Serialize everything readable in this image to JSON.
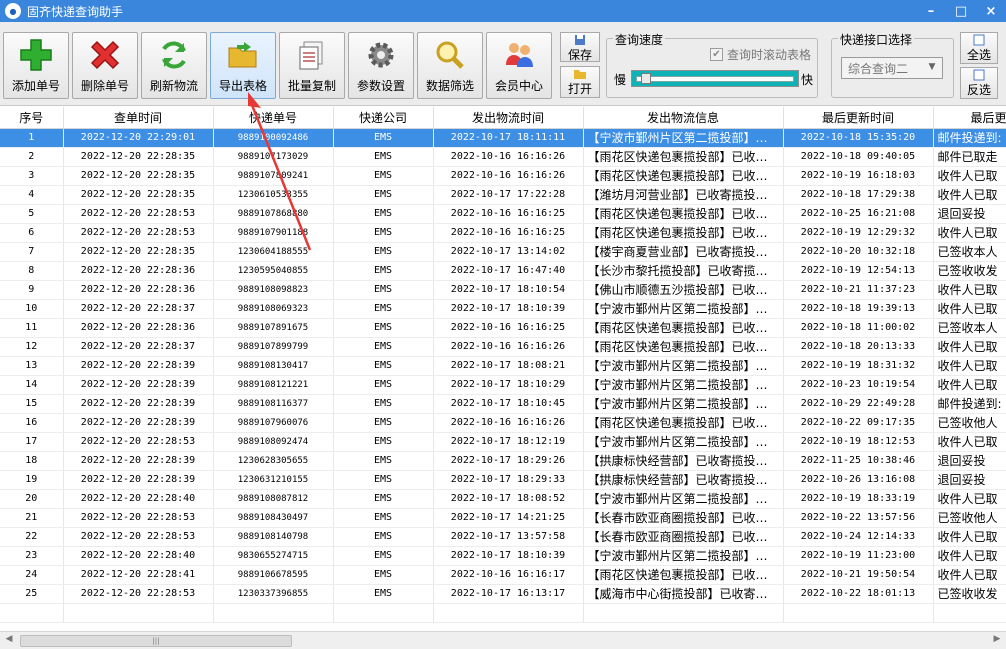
{
  "window": {
    "title": "固齐快递查询助手",
    "minimize": "–",
    "maximize": "□",
    "close": "×"
  },
  "toolbar": {
    "add": "添加单号",
    "delete": "删除单号",
    "refresh": "刷新物流",
    "export": "导出表格",
    "copy": "批量复制",
    "settings": "参数设置",
    "filter": "数据筛选",
    "member": "会员中心",
    "save": "保存",
    "open": "打开",
    "select_all": "全选",
    "invert": "反选"
  },
  "speed": {
    "legend": "查询速度",
    "auto_scroll": "查询时滚动表格",
    "slow": "慢",
    "fast": "快",
    "level": 0.03
  },
  "api": {
    "legend": "快递接口选择",
    "selected": "综合查询二"
  },
  "table": {
    "headers": [
      "序号",
      "查单时间",
      "快递单号",
      "快递公司",
      "发出物流时间",
      "发出物流信息",
      "最后更新时间",
      "最后更新物流"
    ],
    "rows": [
      [
        "1",
        "2022-12-20 22:29:01",
        "9889100092486",
        "EMS",
        "2022-10-17 18:11:11",
        "【宁波市鄞州片区第二揽投部】…",
        "2022-10-18 15:35:20",
        "邮件投递到:"
      ],
      [
        "2",
        "2022-12-20 22:28:35",
        "9889107173029",
        "EMS",
        "2022-10-16 16:16:26",
        "【雨花区快递包裹揽投部】已收…",
        "2022-10-18 09:40:05",
        "邮件已取走"
      ],
      [
        "3",
        "2022-12-20 22:28:35",
        "9889107809241",
        "EMS",
        "2022-10-16 16:16:26",
        "【雨花区快递包裹揽投部】已收…",
        "2022-10-19 16:18:03",
        "收件人已取"
      ],
      [
        "4",
        "2022-12-20 22:28:35",
        "1230610533355",
        "EMS",
        "2022-10-17 17:22:28",
        "【潍坊月河营业部】已收寄揽投…",
        "2022-10-18 17:29:38",
        "收件人已取"
      ],
      [
        "5",
        "2022-12-20 22:28:53",
        "9889107868880",
        "EMS",
        "2022-10-16 16:16:25",
        "【雨花区快递包裹揽投部】已收…",
        "2022-10-25 16:21:08",
        "退回妥投"
      ],
      [
        "6",
        "2022-12-20 22:28:53",
        "9889107901188",
        "EMS",
        "2022-10-16 16:16:25",
        "【雨花区快递包裹揽投部】已收…",
        "2022-10-19 12:29:32",
        "收件人已取"
      ],
      [
        "7",
        "2022-12-20 22:28:35",
        "1230604188555",
        "EMS",
        "2022-10-17 13:14:02",
        "【楼宇商夏营业部】已收寄揽投…",
        "2022-10-20 10:32:18",
        "已签收本人"
      ],
      [
        "8",
        "2022-12-20 22:28:36",
        "1230595040855",
        "EMS",
        "2022-10-17 16:47:40",
        "【长沙市黎托揽投部】已收寄揽…",
        "2022-10-19 12:54:13",
        "已签收收发"
      ],
      [
        "9",
        "2022-12-20 22:28:36",
        "9889108098823",
        "EMS",
        "2022-10-17 18:10:54",
        "【佛山市顺德五沙揽投部】已收…",
        "2022-10-21 11:37:23",
        "收件人已取"
      ],
      [
        "10",
        "2022-12-20 22:28:37",
        "9889108069323",
        "EMS",
        "2022-10-17 18:10:39",
        "【宁波市鄞州片区第二揽投部】…",
        "2022-10-18 19:39:13",
        "收件人已取"
      ],
      [
        "11",
        "2022-12-20 22:28:36",
        "9889107891675",
        "EMS",
        "2022-10-16 16:16:25",
        "【雨花区快递包裹揽投部】已收…",
        "2022-10-18 11:00:02",
        "已签收本人"
      ],
      [
        "12",
        "2022-12-20 22:28:37",
        "9889107899799",
        "EMS",
        "2022-10-16 16:16:26",
        "【雨花区快递包裹揽投部】已收…",
        "2022-10-18 20:13:33",
        "收件人已取"
      ],
      [
        "13",
        "2022-12-20 22:28:39",
        "9889108130417",
        "EMS",
        "2022-10-17 18:08:21",
        "【宁波市鄞州片区第二揽投部】…",
        "2022-10-19 18:31:32",
        "收件人已取"
      ],
      [
        "14",
        "2022-12-20 22:28:39",
        "9889108121221",
        "EMS",
        "2022-10-17 18:10:29",
        "【宁波市鄞州片区第二揽投部】…",
        "2022-10-23 10:19:54",
        "收件人已取"
      ],
      [
        "15",
        "2022-12-20 22:28:39",
        "9889108116377",
        "EMS",
        "2022-10-17 18:10:45",
        "【宁波市鄞州片区第二揽投部】…",
        "2022-10-29 22:49:28",
        "邮件投递到:"
      ],
      [
        "16",
        "2022-12-20 22:28:39",
        "9889107960076",
        "EMS",
        "2022-10-16 16:16:26",
        "【雨花区快递包裹揽投部】已收…",
        "2022-10-22 09:17:35",
        "已签收他人"
      ],
      [
        "17",
        "2022-12-20 22:28:53",
        "9889108092474",
        "EMS",
        "2022-10-17 18:12:19",
        "【宁波市鄞州片区第二揽投部】…",
        "2022-10-19 18:12:53",
        "收件人已取"
      ],
      [
        "18",
        "2022-12-20 22:28:39",
        "1230628305655",
        "EMS",
        "2022-10-17 18:29:26",
        "【拱康标快经营部】已收寄揽投…",
        "2022-11-25 10:38:46",
        "退回妥投"
      ],
      [
        "19",
        "2022-12-20 22:28:39",
        "1230631210155",
        "EMS",
        "2022-10-17 18:29:33",
        "【拱康标快经营部】已收寄揽投…",
        "2022-10-26 13:16:08",
        "退回妥投"
      ],
      [
        "20",
        "2022-12-20 22:28:40",
        "9889108087812",
        "EMS",
        "2022-10-17 18:08:52",
        "【宁波市鄞州片区第二揽投部】…",
        "2022-10-19 18:33:19",
        "收件人已取"
      ],
      [
        "21",
        "2022-12-20 22:28:53",
        "9889108430497",
        "EMS",
        "2022-10-17 14:21:25",
        "【长春市欧亚商圈揽投部】已收…",
        "2022-10-22 13:57:56",
        "已签收他人"
      ],
      [
        "22",
        "2022-12-20 22:28:53",
        "9889108140798",
        "EMS",
        "2022-10-17 13:57:58",
        "【长春市欧亚商圈揽投部】已收…",
        "2022-10-24 12:14:33",
        "收件人已取"
      ],
      [
        "23",
        "2022-12-20 22:28:40",
        "9830655274715",
        "EMS",
        "2022-10-17 18:10:39",
        "【宁波市鄞州片区第二揽投部】…",
        "2022-10-19 11:23:00",
        "收件人已取"
      ],
      [
        "24",
        "2022-12-20 22:28:41",
        "9889106678595",
        "EMS",
        "2022-10-16 16:16:17",
        "【雨花区快递包裹揽投部】已收…",
        "2022-10-21 19:50:54",
        "收件人已取"
      ],
      [
        "25",
        "2022-12-20 22:28:53",
        "1230337396855",
        "EMS",
        "2022-10-17 16:13:17",
        "【威海市中心街揽投部】已收寄…",
        "2022-10-22 18:01:13",
        "已签收收发"
      ]
    ]
  },
  "scrollbar": {
    "grip": "|||"
  },
  "colors": {
    "titlebar": "#3a86dc",
    "selected_row": "#3d8ee5",
    "arrow": "#e53935"
  }
}
